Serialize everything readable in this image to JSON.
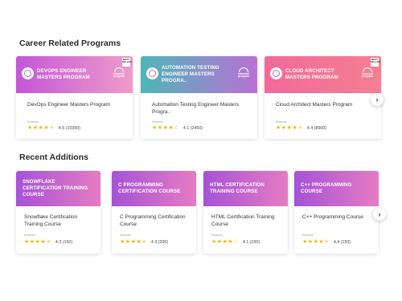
{
  "sections": [
    {
      "title": "Career Related Programs",
      "cards": [
        {
          "banner": "DEVOPS ENGINEER MASTERS PROGRAM",
          "name": "DevOps Engineer Masters Program",
          "rating_label": "Reviews",
          "rating": 4.5,
          "rating_text": "4.5 (10350)",
          "gradient": [
            "#c356d8",
            "#f09bc9"
          ],
          "best_tag": "BEST SELLER",
          "shield_text": "edureka! program"
        },
        {
          "banner": "AUTOMATION TESTING ENGINEER MASTERS PROGRA..",
          "name": "Automation Testing Engineer Masters Progra..",
          "rating_label": "Reviews",
          "rating": 4.1,
          "rating_text": "4.1 (2450)",
          "gradient": [
            "#4db6b8",
            "#b971d4"
          ],
          "best_tag": "",
          "shield_text": "edureka! program"
        },
        {
          "banner": "CLOUD ARCHITECT MASTERS PROGRAM",
          "name": "Cloud Architect Masters Program",
          "rating_label": "Reviews",
          "rating": 4.4,
          "rating_text": "4.4 (8900)",
          "gradient": [
            "#f26a9a",
            "#f47f92"
          ],
          "best_tag": "BEST SELLER",
          "shield_text": "edureka! program"
        }
      ]
    },
    {
      "title": "Recent Additions",
      "cards": [
        {
          "banner": "SNOWFLAKE CERTIFICATION TRAINING COURSE",
          "name": "Snowflake Certification Training Course",
          "rating_label": "Reviews",
          "rating": 4.3,
          "rating_text": "4.3 (150)",
          "gradient": [
            "#a552d7",
            "#e57bc2"
          ]
        },
        {
          "banner": "C PROGRAMMING CERTIFICATION COURSE",
          "name": "C Programming Certification Course",
          "rating_label": "Reviews",
          "rating": 4.3,
          "rating_text": "4.3 (200)",
          "gradient": [
            "#a552d7",
            "#e57bc2"
          ]
        },
        {
          "banner": "HTML CERTIFICATION TRAINING COURSE",
          "name": "HTML Certification Training Course",
          "rating_label": "Reviews",
          "rating": 4.1,
          "rating_text": "4.1 (150)",
          "gradient": [
            "#a552d7",
            "#e57bc2"
          ]
        },
        {
          "banner": "C++ PROGRAMMING COURSE",
          "name": "C++ Programming Course",
          "rating_label": "Reviews",
          "rating": 4.4,
          "rating_text": "4.4 (150)",
          "gradient": [
            "#a552d7",
            "#e57bc2"
          ]
        }
      ]
    }
  ],
  "nav": {
    "next_icon": "chevron-right-icon",
    "next_glyph": "›"
  },
  "colors": {
    "star": "#f4b400",
    "accent": "#c356d8"
  }
}
